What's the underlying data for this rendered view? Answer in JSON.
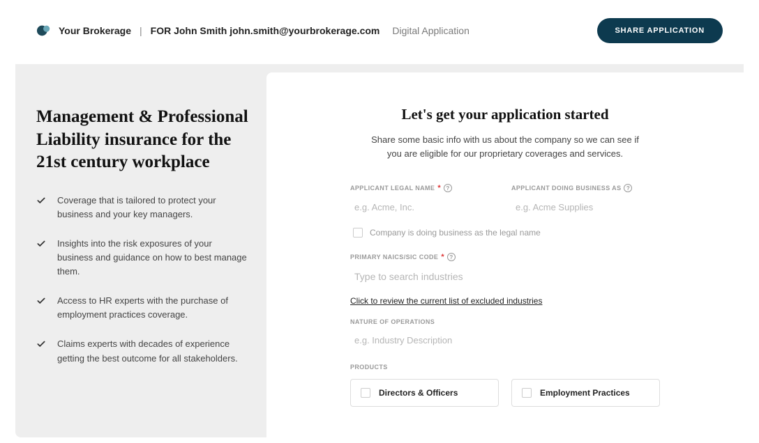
{
  "header": {
    "brokerage": "Your Brokerage",
    "for_prefix": "FOR",
    "user_name": "John Smith",
    "user_email": "john.smith@yourbrokerage.com",
    "app_label": "Digital Application",
    "share_button": "SHARE APPLICATION"
  },
  "left": {
    "title": "Management & Professional Liability insurance for the 21st century workplace",
    "benefits": [
      "Coverage that is tailored to protect your business and your key managers.",
      "Insights into the risk exposures of your business and guidance on how to best manage them.",
      "Access to HR experts with the purchase of employment practices coverage.",
      "Claims experts with decades of experience getting the best outcome for all stakeholders."
    ]
  },
  "form": {
    "title": "Let's get your application started",
    "subtitle": "Share some basic info with us about the company so we can see if you are eligible for our proprietary coverages and services.",
    "legal_name": {
      "label": "APPLICANT LEGAL NAME",
      "placeholder": "e.g. Acme, Inc."
    },
    "dba": {
      "label": "APPLICANT DOING BUSINESS AS",
      "placeholder": "e.g. Acme Supplies"
    },
    "dba_checkbox_label": "Company is doing business as the legal name",
    "naics": {
      "label": "PRIMARY NAICS/SIC CODE",
      "placeholder": "Type to search industries"
    },
    "excluded_link": "Click to review the current list of excluded industries",
    "nature": {
      "label": "NATURE OF OPERATIONS",
      "placeholder": "e.g. Industry Description"
    },
    "products_label": "PRODUCTS",
    "products": [
      "Directors & Officers",
      "Employment Practices"
    ]
  }
}
